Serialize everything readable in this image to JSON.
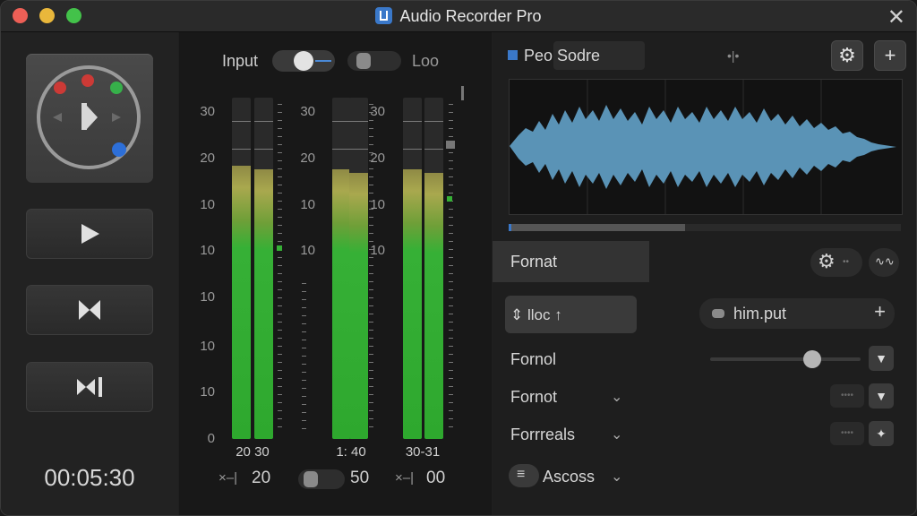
{
  "window": {
    "title": "Audio Recorder Pro"
  },
  "transport": {
    "timer": "00:05:30"
  },
  "meters": {
    "input_label": "Input",
    "loop_label": "Loo",
    "scale": [
      "30",
      "20",
      "10",
      "10",
      "10",
      "10",
      "10",
      "0"
    ],
    "channels": [
      {
        "label": "20 30",
        "value": "20",
        "prefix": "×–|"
      },
      {
        "label": "1: 40",
        "value": "50",
        "prefix": ""
      },
      {
        "label": "30-31",
        "value": "00",
        "prefix": "×–|"
      }
    ]
  },
  "waveform": {
    "source_label": "Peo Sodre",
    "progress": 0.45,
    "color": "#5a93b6"
  },
  "format_panel": {
    "header": "Fornat",
    "selected_item": "⇕ lloc ↑",
    "items": [
      "Fornol",
      "Fornot",
      "Forrreals"
    ],
    "last_item": "Ascoss",
    "input_field": "him.put",
    "slider_level": 0.68
  },
  "colors": {
    "meter_green": "#36b036",
    "meter_yellow": "#a9a84e",
    "accent_blue": "#3a78c9"
  },
  "icons": [
    "app-icon",
    "close-icon",
    "play-icon",
    "stop-icon",
    "skip-icon",
    "gear-icon",
    "plus-icon",
    "chevron-down-icon",
    "menu-icon"
  ]
}
